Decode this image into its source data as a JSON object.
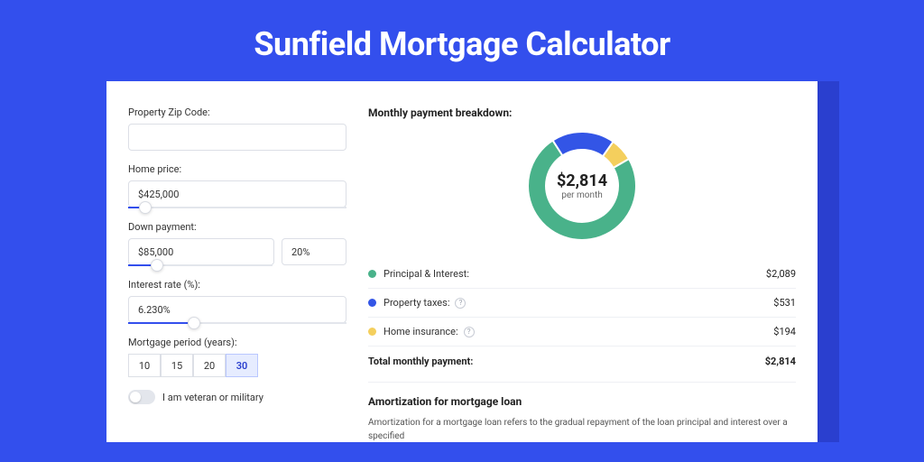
{
  "hero": {
    "title": "Sunfield Mortgage Calculator"
  },
  "form": {
    "zip": {
      "label": "Property Zip Code:",
      "value": ""
    },
    "price": {
      "label": "Home price:",
      "value": "$425,000",
      "slider_pct": 8
    },
    "down": {
      "label": "Down payment:",
      "amount": "$85,000",
      "percent": "20%",
      "slider_pct": 20
    },
    "rate": {
      "label": "Interest rate (%):",
      "value": "6.230%",
      "slider_pct": 30
    },
    "period": {
      "label": "Mortgage period (years):",
      "options": [
        "10",
        "15",
        "20",
        "30"
      ],
      "selected": "30"
    },
    "veteran": {
      "label": "I am veteran or military",
      "checked": false
    }
  },
  "breakdown": {
    "title": "Monthly payment breakdown:",
    "center_amount": "$2,814",
    "center_sub": "per month",
    "items": [
      {
        "label": "Principal & Interest:",
        "value": "$2,089",
        "color": "#49b28a",
        "info": false
      },
      {
        "label": "Property taxes:",
        "value": "$531",
        "color": "#3355e6",
        "info": true
      },
      {
        "label": "Home insurance:",
        "value": "$194",
        "color": "#f4cf5d",
        "info": true
      }
    ],
    "total_label": "Total monthly payment:",
    "total_value": "$2,814"
  },
  "amort": {
    "title": "Amortization for mortgage loan",
    "body": "Amortization for a mortgage loan refers to the gradual repayment of the loan principal and interest over a specified"
  },
  "chart_data": {
    "type": "pie",
    "title": "Monthly payment breakdown",
    "categories": [
      "Principal & Interest",
      "Property taxes",
      "Home insurance"
    ],
    "values": [
      2089,
      531,
      194
    ],
    "colors": [
      "#49b28a",
      "#3355e6",
      "#f4cf5d"
    ],
    "total": 2814,
    "is_donut": true,
    "start_angle_deg": -30
  }
}
